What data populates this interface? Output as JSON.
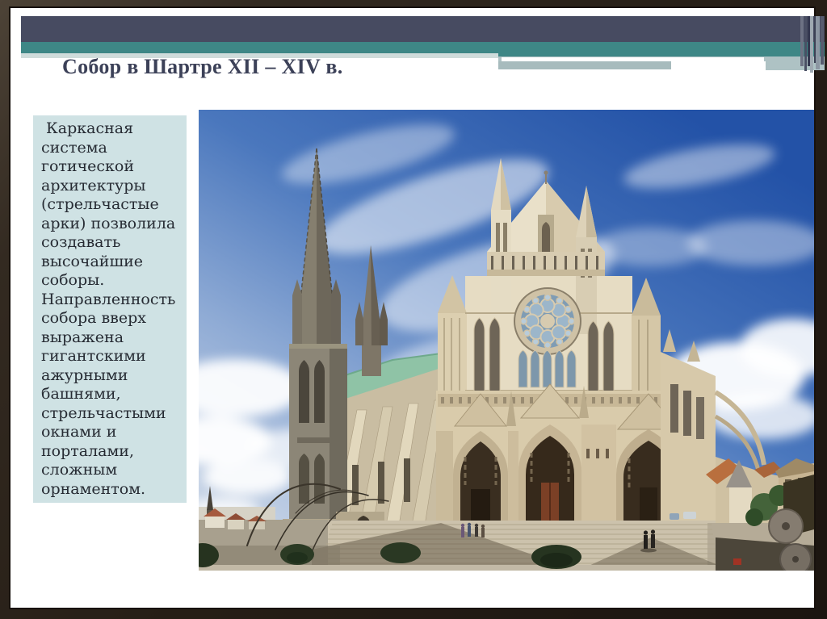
{
  "slide": {
    "title": "Собор в Шартре XII – XIV в.",
    "body_text": " Каркасная система готической архитектуры (стрельчастые арки) позволила создавать высочайшие соборы. Направленность собора вверх выражена гигантскими ажурными башнями, стрельчастыми окнами и порталами, сложным орнаментом."
  },
  "palette": {
    "frame_brown": "#2a221a",
    "header_navy": "#474b61",
    "header_teal": "#3e8786",
    "header_pale_stripe": "#cfdcdb",
    "header_gray_stripe": "#a7bbbd",
    "text_block_bg": "#cfe2e4",
    "title_color": "#3c4158",
    "sky_blue": "#2352a7",
    "stone_cream": "#e6dcc3",
    "roof_green": "#8fc3a6"
  }
}
